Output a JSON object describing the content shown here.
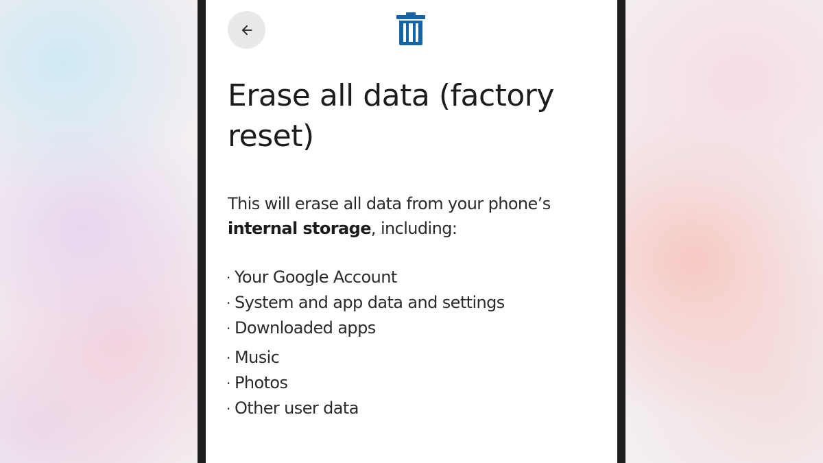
{
  "header": {
    "back_icon": "arrow-back-icon",
    "delete_icon": "trash-icon",
    "accent_color": "#1565a6"
  },
  "title": "Erase all data (factory reset)",
  "intro": {
    "prefix": "This will erase all data from your phone’s",
    "bold": "internal storage",
    "suffix": ", including:"
  },
  "items": {
    "bullet": "·",
    "list": [
      "Your Google Account",
      "System and app data and settings",
      "Downloaded apps",
      "Music",
      "Photos",
      "Other user data"
    ]
  }
}
